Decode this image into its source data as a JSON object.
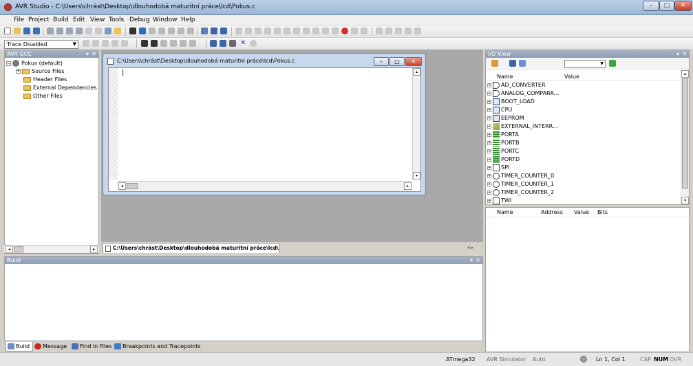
{
  "window": {
    "title": "AVR Studio - C:\\Users\\chrást\\Desktop\\dlouhodobá maturitní práce\\lcd\\Pokus.c",
    "min": "–",
    "max": "□",
    "close": "✕"
  },
  "menu": [
    "File",
    "Project",
    "Build",
    "Edit",
    "View",
    "Tools",
    "Debug",
    "Window",
    "Help"
  ],
  "toolbar": {
    "trace_select": "Trace Disabled"
  },
  "project_panel": {
    "header": "AVR GCC",
    "tree": [
      {
        "label": "Pokus (default)",
        "expander": "−"
      },
      {
        "label": "Source Files",
        "expander": "+"
      },
      {
        "label": "Header Files",
        "expander": ""
      },
      {
        "label": "External Dependencies",
        "expander": ""
      },
      {
        "label": "Other Files",
        "expander": ""
      }
    ]
  },
  "document": {
    "title": "C:\\Users\\chrást\\Desktop\\dlouhodobá maturitní práce\\lcd\\Pokus.c",
    "tab_label": "C:\\Users\\chrást\\Desktop\\dlouhodobá maturitní práce\\lcd\\Pokus.c",
    "tab_nav": "◂ ▸",
    "caret": "|"
  },
  "build_panel": {
    "header": "Build"
  },
  "bottom_tabs": [
    "Build",
    "Message",
    "Find in Files",
    "Breakpoints and Tracepoints"
  ],
  "io_view": {
    "header": "I/O View",
    "columns": {
      "name": "Name",
      "value": "Value"
    },
    "items": [
      "AD_CONVERTER",
      "ANALOG_COMPARA...",
      "BOOT_LOAD",
      "CPU",
      "EEPROM",
      "EXTERNAL_INTERR...",
      "PORTA",
      "PORTB",
      "PORTC",
      "PORTD",
      "SPI",
      "TIMER_COUNTER_0",
      "TIMER_COUNTER_1",
      "TIMER_COUNTER_2",
      "TWI"
    ],
    "lower_columns": {
      "name": "Name",
      "address": "Address",
      "value": "Value",
      "bits": "Bits"
    }
  },
  "status": {
    "device": "ATmega32",
    "simulator": "AVR Simulator",
    "mode": "Auto",
    "position": "Ln 1, Col 1",
    "cap": "CAP",
    "num": "NUM",
    "ovr": "OVR"
  },
  "colors": {
    "panel_header": "#8d9db2",
    "mdi_background": "#a9a9a9",
    "window_frame": "#c7d8ee"
  },
  "icons": {
    "app": "avr-studio-icon",
    "project": "gear-icon",
    "folder": "folder-icon",
    "document": "document-icon",
    "io_module": "io-module-icon",
    "port": "port-icon",
    "timer": "timer-icon",
    "led": "status-led-icon"
  }
}
